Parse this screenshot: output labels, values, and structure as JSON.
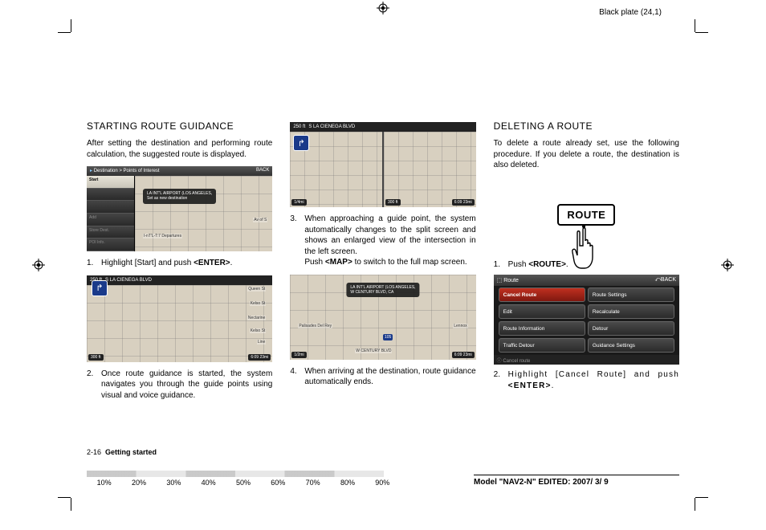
{
  "plate_label": "Black plate (24,1)",
  "col1": {
    "heading": "STARTING ROUTE GUIDANCE",
    "intro": "After setting the destination and performing route calculation, the suggested route is displayed.",
    "fig1": {
      "breadcrumb": "Destination > Points of Interest",
      "back": "BACK",
      "sidebar": [
        "Start",
        "",
        "",
        "Add",
        "Store Dest.",
        "POI Info."
      ],
      "tooltip": "LA INT'L AIRPORT (LOS ANGELES,\nSet as new destination",
      "mapnote": "Av of S",
      "poi": "I-nT'L-T:7 Departures"
    },
    "step1": "Highlight [Start] and push <ENTER>.",
    "fig2": {
      "header_dist": "250 ft",
      "header_road": "S LA CIENEGA BLVD",
      "labels": [
        "Queen St",
        "Kelso St",
        "Nectarine",
        "Kelso St",
        "Line",
        "6:09 23mi"
      ],
      "scale": "300 ft"
    },
    "step2": "Once route guidance is started, the system navigates you through the guide points using visual and voice guidance."
  },
  "col2": {
    "fig3": {
      "header_dist": "250 ft",
      "header_road": "S LA CIENEGA BLVD",
      "scale_l": "1/4mi",
      "scale_r": "300 ft",
      "compass": "6:09 23mi"
    },
    "step3": "When approaching a guide point, the system automatically changes to the split screen and shows an enlarged view of the intersection in the left screen.\nPush <MAP> to switch to the full map screen.",
    "fig4": {
      "tooltip": "LA INT'L AIRPORT (LOS ANGELES,\nW CENTURY BLVD, CA",
      "labels": [
        "Palisades Del Rey",
        "Lennox",
        "105",
        "W CENTURY BLVD"
      ],
      "scale": "1/2mi",
      "compass": "6:09 23mi"
    },
    "step4": "When arriving at the destination, route guidance automatically ends."
  },
  "col3": {
    "heading": "DELETING A ROUTE",
    "intro": "To delete a route already set, use the following procedure. If you delete a route, the destination is also deleted.",
    "route_btn": "ROUTE",
    "step1": "Push <ROUTE>.",
    "menu": {
      "title": "Route",
      "back": "BACK",
      "items_left": [
        "Cancel Route",
        "Edit",
        "Route Information",
        "Traffic Detour"
      ],
      "items_right": [
        "Route Settings",
        "Recalculate",
        "Detour",
        "Guidance Settings"
      ],
      "footer": "Cancel route"
    },
    "step2": "Highlight [Cancel Route] and push <ENTER>."
  },
  "footer": {
    "page": "2-16",
    "section": "Getting started",
    "model": "Model \"NAV2-N\" EDITED: 2007/ 3/ 9",
    "percents": [
      "10%",
      "20%",
      "30%",
      "40%",
      "50%",
      "60%",
      "70%",
      "80%",
      "90%"
    ]
  }
}
